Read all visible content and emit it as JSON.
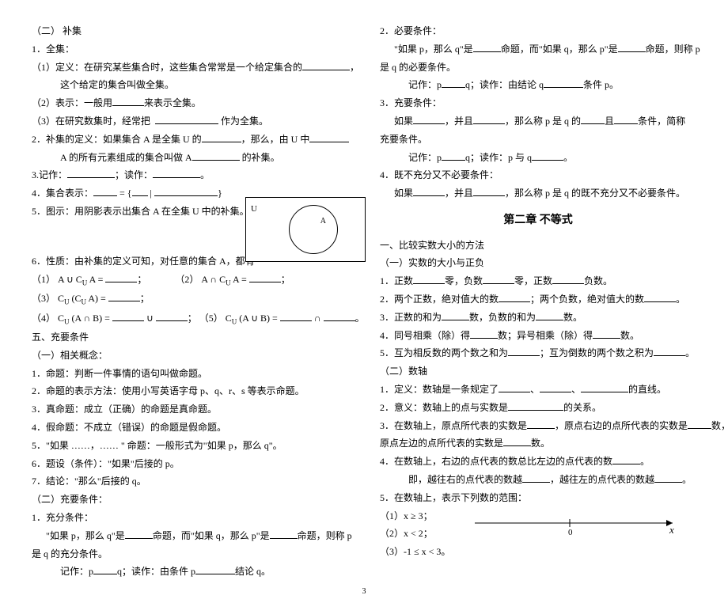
{
  "left": {
    "h1": "（二） 补集",
    "l1": "1．全集：",
    "l2a": "（1）定义：在研究某些集合时，这些集合常常是一个给定集合的",
    "l2b": "，",
    "l3": "这个给定的集合叫做全集。",
    "l4a": "（2）表示：一般用",
    "l4b": "来表示全集。",
    "l5a": "（3）在研究数集时，经常把",
    "l5b": "作为全集。",
    "l6a": "2．补集的定义：如果集合 A 是全集 U 的",
    "l6b": "，那么，由 U 中",
    "l7a": "A 的所有元素组成的集合叫做 A",
    "l7b": "的补集。",
    "l8a": "3.记作：",
    "l8b": "；读作：",
    "l8c": "。",
    "l9a": "4．集合表示：",
    "l9b": " = {",
    "l9c": " | ",
    "l9d": "}",
    "l10": "5．图示：用阴影表示出集合 A 在全集 U 中的补集。",
    "vennU": "U",
    "vennA": "A",
    "l11": "6．性质：由补集的定义可知，对任意的集合   A，都有",
    "l12a": "（1） A ∪ C",
    "l12sub": "U",
    "l12b": " A = ",
    "l12c": "；",
    "l12d": "（2） A ∩ C",
    "l12e": " A = ",
    "l12f": "；",
    "l13a": "（3） C",
    "l13b": " (C",
    "l13c": " A) = ",
    "l13d": "；",
    "l14a": "（4） C",
    "l14b": " (A ∩ B) = ",
    "l14c": " ∪ ",
    "l14d": "；   （5） C",
    "l14e": " (A ∪ B) = ",
    "l14f": " ∩ ",
    "l14g": "。",
    "h2": "五、充要条件",
    "h3": "（一）相关概念：",
    "l15": "1．命题：判断一件事情的语句叫做命题。",
    "l16": "2．命题的表示方法：使用小写英语字母 p、q、r、s 等表示命题。",
    "l17": "3．真命题：成立（正确）的命题是真命题。",
    "l18": "4．假命题：不成立（错误）的命题是假命题。",
    "l19": "5．\"如果 ……，…… \" 命题：一般形式为\"如果 p，那么 q\"。",
    "l20": "6．题设（条件）：\"如果\"后接的 p。",
    "l21": "7．结论：\"那么\"后接的 q。",
    "h4": "（二）充要条件：",
    "l22": "1．充分条件：",
    "l23a": "\"如果 p，那么 q\"是",
    "l23b": "命题，而\"如果 q，那么 p\"是",
    "l23c": "命题，则称   p",
    "l24": "是 q 的充分条件。",
    "l25a": "记作：p",
    "l25b": "q；读作：由条件 p",
    "l25c": "结论 q。"
  },
  "right": {
    "l1": "2．必要条件：",
    "l2a": "\"如果 p，那么 q\"是",
    "l2b": "命题，而\"如果 q，那么 p\"是",
    "l2c": "命题，则称 p",
    "l3": "是 q 的必要条件。",
    "l4a": "记作：p",
    "l4b": "q；读作：由结论 q",
    "l4c": "条件 p。",
    "l5": "3．充要条件：",
    "l6a": "如果",
    "l6b": "，并且",
    "l6c": "，那么称 p 是 q 的",
    "l6d": "且",
    "l6e": "条件，简称",
    "l7": "充要条件。",
    "l8a": "记作：p",
    "l8b": "q；读作：p 与 q",
    "l8c": "。",
    "l9": "4．既不充分又不必要条件：",
    "l10a": "如果",
    "l10b": "，并且",
    "l10c": "，那么称 p 是 q 的既不充分又不必要条件。",
    "chapter": "第二章    不等式",
    "h1": "一、比较实数大小的方法",
    "h2": "（一）实数的大小与正负",
    "l11a": "1．正数",
    "l11b": "零，负数",
    "l11c": "零，正数",
    "l11d": "负数。",
    "l12a": "2．两个正数，绝对值大的数",
    "l12b": "；两个负数，绝对值大的数",
    "l12c": "。",
    "l13a": "3．正数的和为",
    "l13b": "数，负数的和为",
    "l13c": "数。",
    "l14a": "4．同号相乘（除）得",
    "l14b": "数；异号相乘（除）得",
    "l14c": "数。",
    "l15a": "5．互为相反数的两个数之和为",
    "l15b": "；互为倒数的两个数之积为",
    "l15c": "。",
    "h3": "（二）数轴",
    "l16a": "1．定义：数轴是一条规定了",
    "l16b": "、",
    "l16c": "、",
    "l16d": "的直线。",
    "l17a": "2．意义：数轴上的点与实数是",
    "l17b": "的关系。",
    "l18a": "3．在数轴上，原点所代表的实数是",
    "l18b": "，原点右边的点所代表的实数是",
    "l18c": "数，",
    "l19a": "原点左边的点所代表的实数是",
    "l19b": "数。",
    "l20a": "4．在数轴上，右边的点代表的数总比左边的点代表的数",
    "l20b": "。",
    "l21a": "即，越往右的点代表的数越",
    "l21b": "，越往左的点代表的数越",
    "l21c": "。",
    "l22": "5．在数轴上，表示下列数的范围：",
    "l23": "（1）x ≥ 3；",
    "l24": "（2）x < 2；",
    "l25": "（3）-1 ≤ x < 3。",
    "axis0": "0",
    "axisX": "x"
  },
  "pageNum": "3"
}
